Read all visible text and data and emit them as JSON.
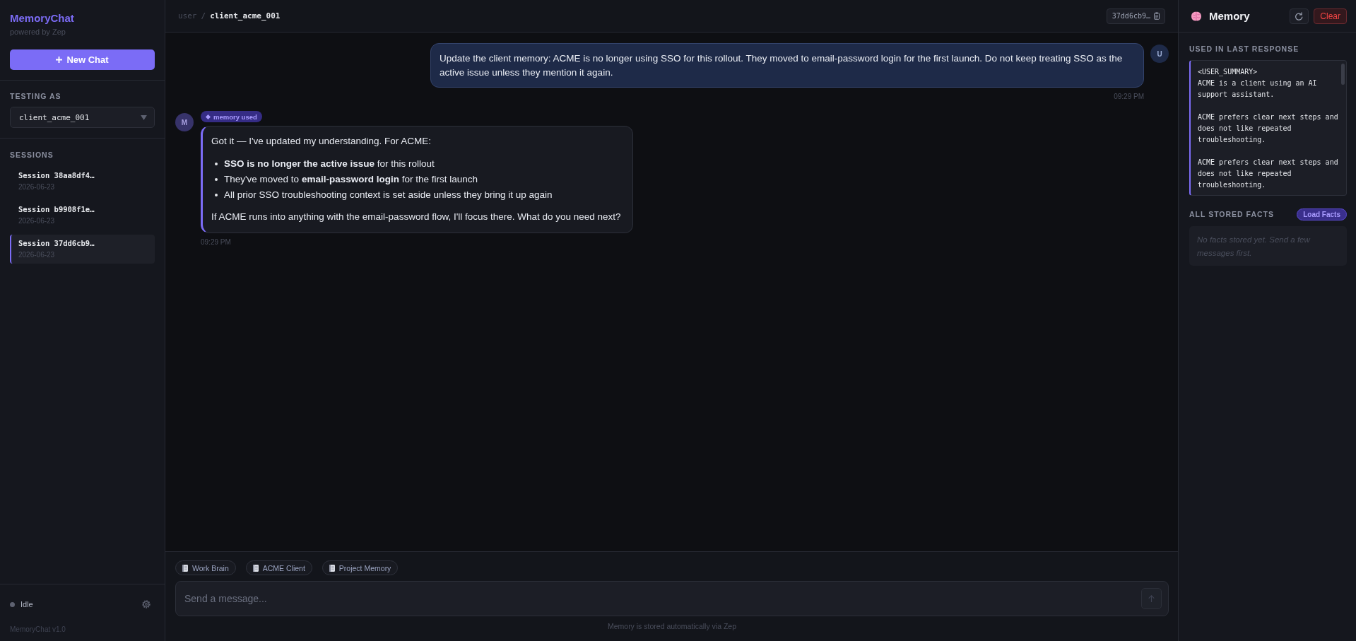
{
  "sidebar": {
    "brand": "MemoryChat",
    "tagline": "powered by Zep",
    "new_chat": "New Chat",
    "testing_as": {
      "label": "TESTING AS",
      "value": "client_acme_001"
    },
    "sessions": {
      "label": "SESSIONS",
      "items": [
        {
          "title": "Session 38aa8df4…",
          "date": "2026-06-23",
          "selected": false
        },
        {
          "title": "Session b9908f1e…",
          "date": "2026-06-23",
          "selected": false
        },
        {
          "title": "Session 37dd6cb9…",
          "date": "2026-06-23",
          "selected": true
        }
      ]
    },
    "status": {
      "label": "Idle"
    },
    "version": "MemoryChat v1.0"
  },
  "header": {
    "path_root": "user",
    "separator": "/",
    "user_id": "client_acme_001",
    "session_id": "37dd6cb9…"
  },
  "messages": [
    {
      "kind": "user",
      "avatar": "U",
      "blocks": [
        {
          "kind": "paragraph",
          "text": "Update the client memory: ACME is no longer using SSO for this rollout. They moved to email-password login for the first launch. Do not keep treating SSO as the active issue unless they mention it again."
        }
      ],
      "time": "09:29 PM"
    },
    {
      "kind": "assistant",
      "avatar": "M",
      "badge": "memory used",
      "blocks": [
        {
          "kind": "paragraph",
          "text": "Got it — I've updated my understanding. For ACME:"
        },
        {
          "kind": "list",
          "items": [
            "**SSO is no longer the active issue** for this rollout",
            "They've moved to **email-password login** for the first launch",
            "All prior SSO troubleshooting context is set aside unless they bring it up again"
          ]
        },
        {
          "kind": "paragraph",
          "text": "If ACME runs into anything with the email-password flow, I'll focus there. What do you need next?"
        }
      ],
      "time": "09:29 PM"
    }
  ],
  "composer": {
    "chips": [
      "Work Brain",
      "ACME Client",
      "Project Memory"
    ],
    "placeholder": "Send a message...",
    "send_disabled": true,
    "footer": "Memory is stored automatically via Zep"
  },
  "memory": {
    "title": "Memory",
    "clear": "Clear",
    "context": {
      "label": "USED IN LAST RESPONSE",
      "text": "<USER_SUMMARY>\nACME is a client using an AI support assistant.\n\nACME prefers clear next steps and does not like repeated troubleshooting.\n\nACME prefers clear next steps and does not like repeated troubleshooting."
    },
    "facts": {
      "label": "ALL STORED FACTS",
      "button": "Load Facts",
      "empty": "No facts stored yet. Send a few messages first."
    }
  }
}
